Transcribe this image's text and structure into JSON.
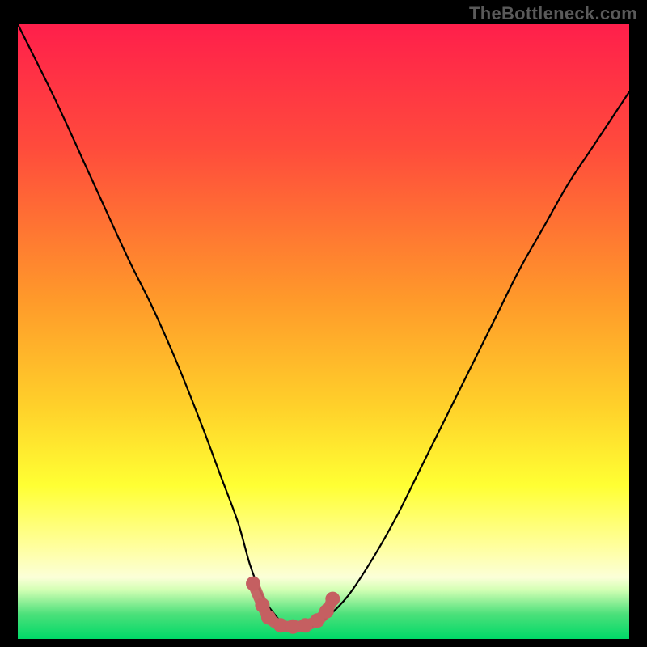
{
  "watermark": "TheBottleneck.com",
  "chart_data": {
    "type": "line",
    "title": "",
    "xlabel": "",
    "ylabel": "",
    "xlim": [
      0,
      100
    ],
    "ylim": [
      0,
      100
    ],
    "gradient_stops": [
      {
        "offset": 0,
        "color": "#ff1f4b"
      },
      {
        "offset": 20,
        "color": "#ff4b3c"
      },
      {
        "offset": 45,
        "color": "#ff9a2a"
      },
      {
        "offset": 62,
        "color": "#ffd02a"
      },
      {
        "offset": 75,
        "color": "#ffff33"
      },
      {
        "offset": 85,
        "color": "#ffff9e"
      },
      {
        "offset": 90,
        "color": "#fbffd8"
      },
      {
        "offset": 92,
        "color": "#d3ffb4"
      },
      {
        "offset": 96,
        "color": "#4be07a"
      },
      {
        "offset": 100,
        "color": "#00d968"
      }
    ],
    "series": [
      {
        "name": "bottleneck-curve",
        "x": [
          0,
          6,
          12,
          18,
          22,
          26,
          30,
          33,
          36,
          38,
          40,
          42,
          44,
          46,
          48,
          50,
          54,
          58,
          62,
          66,
          70,
          74,
          78,
          82,
          86,
          90,
          94,
          98,
          100
        ],
        "y": [
          100,
          88,
          75,
          62,
          54,
          45,
          35,
          27,
          19,
          12,
          7,
          4,
          2,
          2,
          2,
          3,
          7,
          13,
          20,
          28,
          36,
          44,
          52,
          60,
          67,
          74,
          80,
          86,
          89
        ]
      }
    ],
    "markers": {
      "name": "valley-dots",
      "color": "#c55f61",
      "points": [
        {
          "x": 38.5,
          "y": 9.0
        },
        {
          "x": 40.0,
          "y": 5.5
        },
        {
          "x": 41.0,
          "y": 3.5
        },
        {
          "x": 43.0,
          "y": 2.2
        },
        {
          "x": 45.0,
          "y": 2.0
        },
        {
          "x": 47.0,
          "y": 2.2
        },
        {
          "x": 49.0,
          "y": 3.0
        },
        {
          "x": 50.5,
          "y": 4.5
        },
        {
          "x": 51.5,
          "y": 6.5
        }
      ]
    }
  }
}
